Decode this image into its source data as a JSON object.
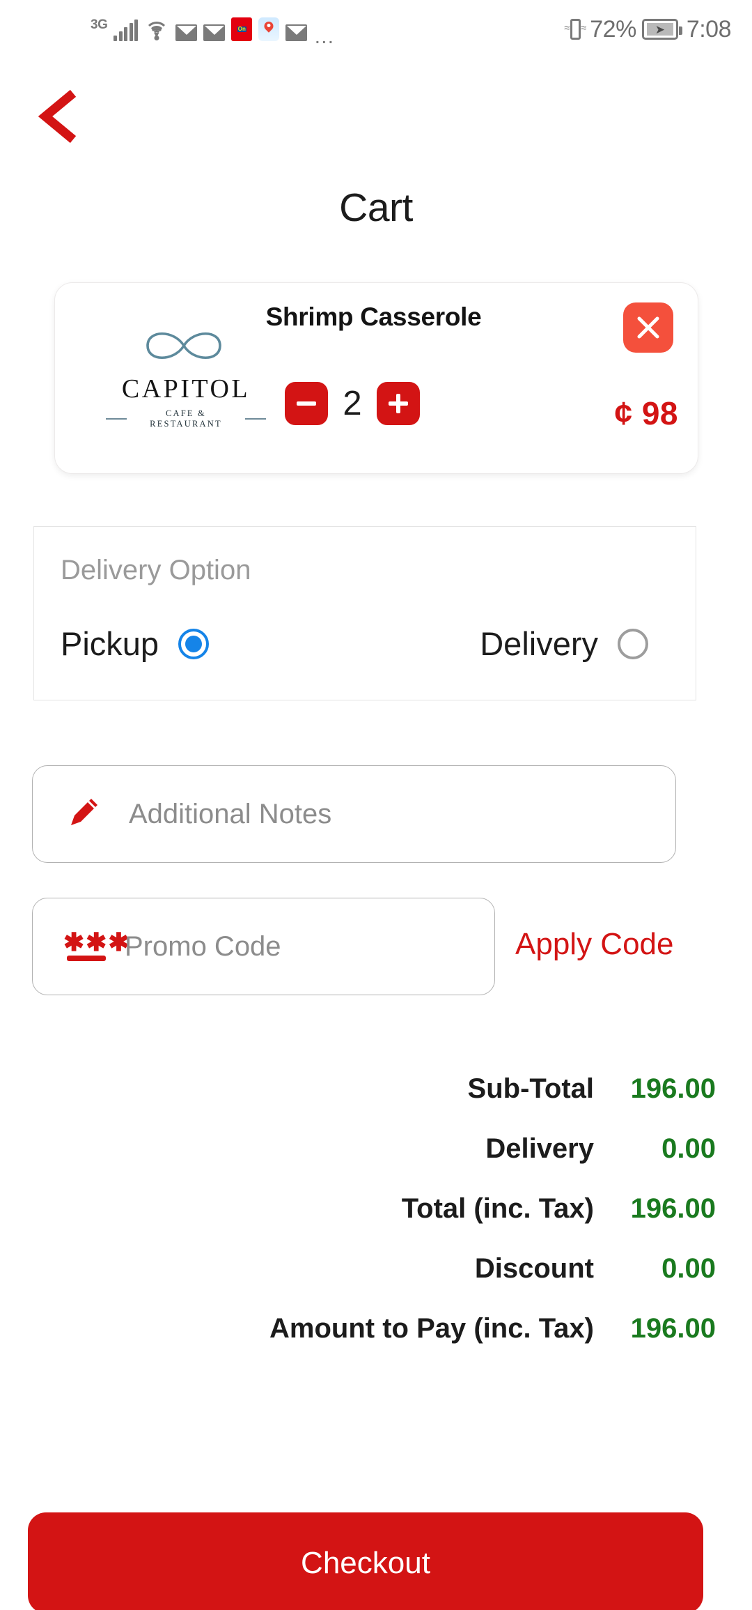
{
  "status_bar": {
    "network_type": "3G",
    "battery_percent": "72%",
    "time": "7:08",
    "overflow": "…",
    "icons": [
      "signal-bars-icon",
      "wifi-icon",
      "mail-icon",
      "mail-icon",
      "app-notification-icon",
      "maps-icon",
      "mail-icon",
      "more-dots-icon",
      "vibrate-icon",
      "battery-charging-icon"
    ]
  },
  "nav": {
    "back_label": "back-chevron",
    "title": "Cart"
  },
  "cart_item": {
    "name": "Shrimp Casserole",
    "brand_name": "CAPITOL",
    "brand_tagline": "CAFE & RESTAURANT",
    "quantity": "2",
    "decrement_label": "−",
    "increment_label": "+",
    "remove_label": "✕",
    "price": "¢ 98"
  },
  "delivery_option": {
    "label": "Delivery Option",
    "options": [
      {
        "label": "Pickup",
        "selected": true
      },
      {
        "label": "Delivery",
        "selected": false
      }
    ]
  },
  "notes": {
    "placeholder": "Additional Notes",
    "value": "",
    "icon": "pencil-icon"
  },
  "promo": {
    "placeholder": "Promo Code",
    "value": "",
    "icon": "password-asterisks-icon",
    "apply_label": "Apply Code"
  },
  "totals": {
    "rows": [
      {
        "label": "Sub-Total",
        "value": "196.00"
      },
      {
        "label": "Delivery",
        "value": "0.00"
      },
      {
        "label": "Total (inc. Tax)",
        "value": "196.00"
      },
      {
        "label": "Discount",
        "value": "0.00"
      },
      {
        "label": "Amount to Pay (inc. Tax)",
        "value": "196.00"
      }
    ]
  },
  "checkout": {
    "label": "Checkout"
  },
  "colors": {
    "brand_red": "#d31414",
    "remove_red": "#f4503c",
    "radio_blue": "#1584e8",
    "total_green": "#1a7a1f",
    "muted_gray": "#8c8c8c"
  }
}
